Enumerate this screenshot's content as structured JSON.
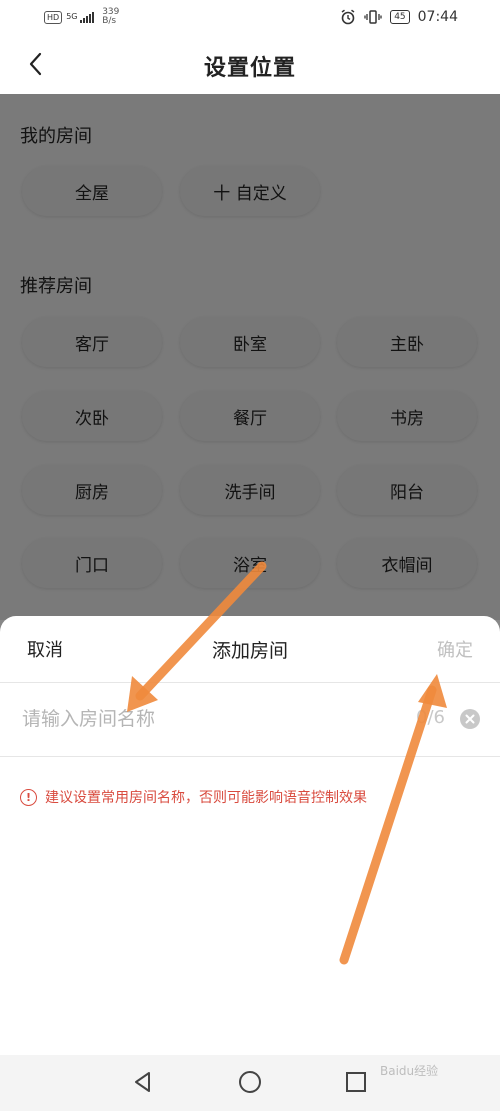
{
  "status_bar": {
    "hd": "HD",
    "network": "5G",
    "speed_value": "339",
    "speed_unit": "B/s",
    "battery": "45",
    "time": "07:44"
  },
  "header": {
    "title": "设置位置"
  },
  "my_rooms": {
    "title": "我的房间",
    "items": [
      "全屋",
      "十 自定义"
    ]
  },
  "recommended_rooms": {
    "title": "推荐房间",
    "items": [
      "客厅",
      "卧室",
      "主卧",
      "次卧",
      "餐厅",
      "书房",
      "厨房",
      "洗手间",
      "阳台",
      "门口",
      "浴室",
      "衣帽间"
    ]
  },
  "sheet": {
    "cancel_label": "取消",
    "title": "添加房间",
    "confirm_label": "确定",
    "input_placeholder": "请输入房间名称",
    "counter": "0/6",
    "warning": "建议设置常用房间名称，否则可能影响语音控制效果"
  },
  "watermark": "Baidu经验",
  "colors": {
    "warning": "#d94b3f",
    "annotation_arrow": "#f08a3c"
  }
}
